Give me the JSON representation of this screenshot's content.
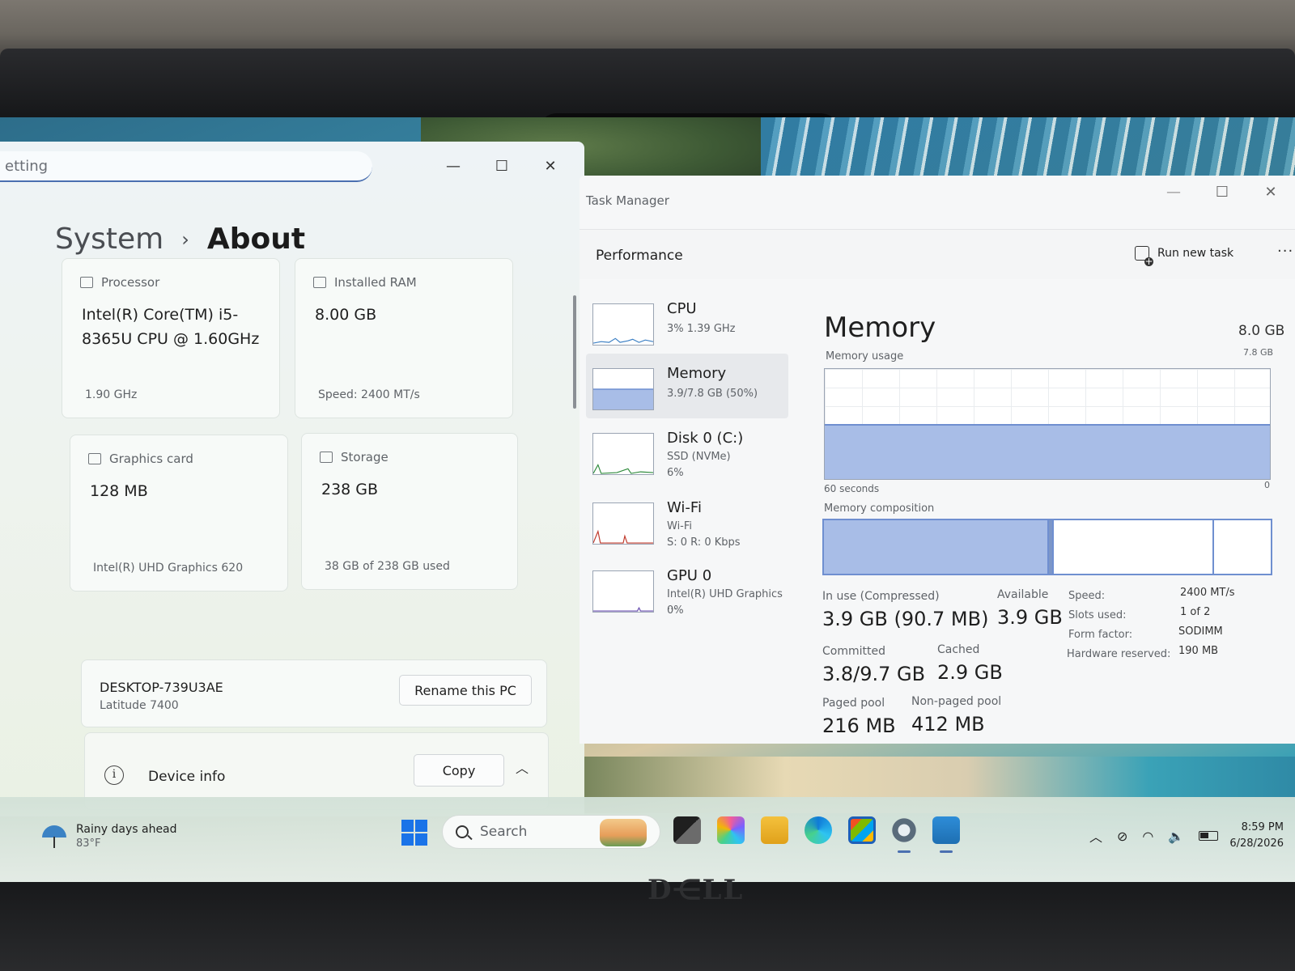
{
  "settings": {
    "search_placeholder": "etting",
    "breadcrumb": {
      "parent": "System",
      "separator": "›",
      "current": "About"
    },
    "cards": {
      "processor": {
        "label": "Processor",
        "value": "Intel(R) Core(TM) i5-8365U CPU @ 1.60GHz",
        "sub": "1.90 GHz"
      },
      "ram": {
        "label": "Installed RAM",
        "value": "8.00 GB",
        "sub": "Speed: 2400 MT/s"
      },
      "graphics": {
        "label": "Graphics card",
        "value": "128 MB",
        "sub": "Intel(R) UHD Graphics 620"
      },
      "storage": {
        "label": "Storage",
        "value": "238 GB",
        "sub": "38 GB of 238 GB used"
      }
    },
    "pc": {
      "name": "DESKTOP-739U3AE",
      "model": "Latitude 7400",
      "rename_label": "Rename this PC"
    },
    "device_info": {
      "label": "Device info",
      "copy_label": "Copy"
    }
  },
  "taskmgr": {
    "title": "Task Manager",
    "section": "Performance",
    "run_new_task": "Run new task",
    "sidebar": [
      {
        "name": "CPU",
        "line1": "3%  1.39 GHz",
        "line2": ""
      },
      {
        "name": "Memory",
        "line1": "3.9/7.8 GB (50%)",
        "line2": ""
      },
      {
        "name": "Disk 0 (C:)",
        "line1": "SSD (NVMe)",
        "line2": "6%"
      },
      {
        "name": "Wi-Fi",
        "line1": "Wi-Fi",
        "line2": "S: 0  R: 0 Kbps"
      },
      {
        "name": "GPU 0",
        "line1": "Intel(R) UHD Graphics ...",
        "line2": "0%"
      }
    ],
    "memory": {
      "title": "Memory",
      "total": "8.0 GB",
      "usage_label": "Memory usage",
      "usage_max": "7.8 GB",
      "usage_fraction": 0.5,
      "time_label": "60 seconds",
      "time_end": "0",
      "composition_label": "Memory composition",
      "composition": {
        "in_use": 0.5,
        "modified": 0.01,
        "standby": 0.36,
        "free": 0.13
      },
      "stats": {
        "in_use_label": "In use (Compressed)",
        "in_use_value": "3.9 GB (90.7 MB)",
        "available_label": "Available",
        "available_value": "3.9 GB",
        "committed_label": "Committed",
        "committed_value": "3.8/9.7 GB",
        "cached_label": "Cached",
        "cached_value": "2.9 GB",
        "paged_label": "Paged pool",
        "paged_value": "216 MB",
        "nonpaged_label": "Non-paged pool",
        "nonpaged_value": "412 MB"
      },
      "details": [
        {
          "label": "Speed:",
          "value": "2400 MT/s"
        },
        {
          "label": "Slots used:",
          "value": "1 of 2"
        },
        {
          "label": "Form factor:",
          "value": "SODIMM"
        },
        {
          "label": "Hardware reserved:",
          "value": "190 MB"
        }
      ]
    }
  },
  "taskbar": {
    "weather": {
      "title": "Rainy days ahead",
      "temp": "83°F"
    },
    "search_label": "Search",
    "clock": {
      "time": "8:59 PM",
      "date": "6/28/2026"
    }
  },
  "colors": {
    "accent": "#4a6fb0",
    "memory_fill": "#a8bde7",
    "memory_stroke": "#6f8fd0"
  }
}
